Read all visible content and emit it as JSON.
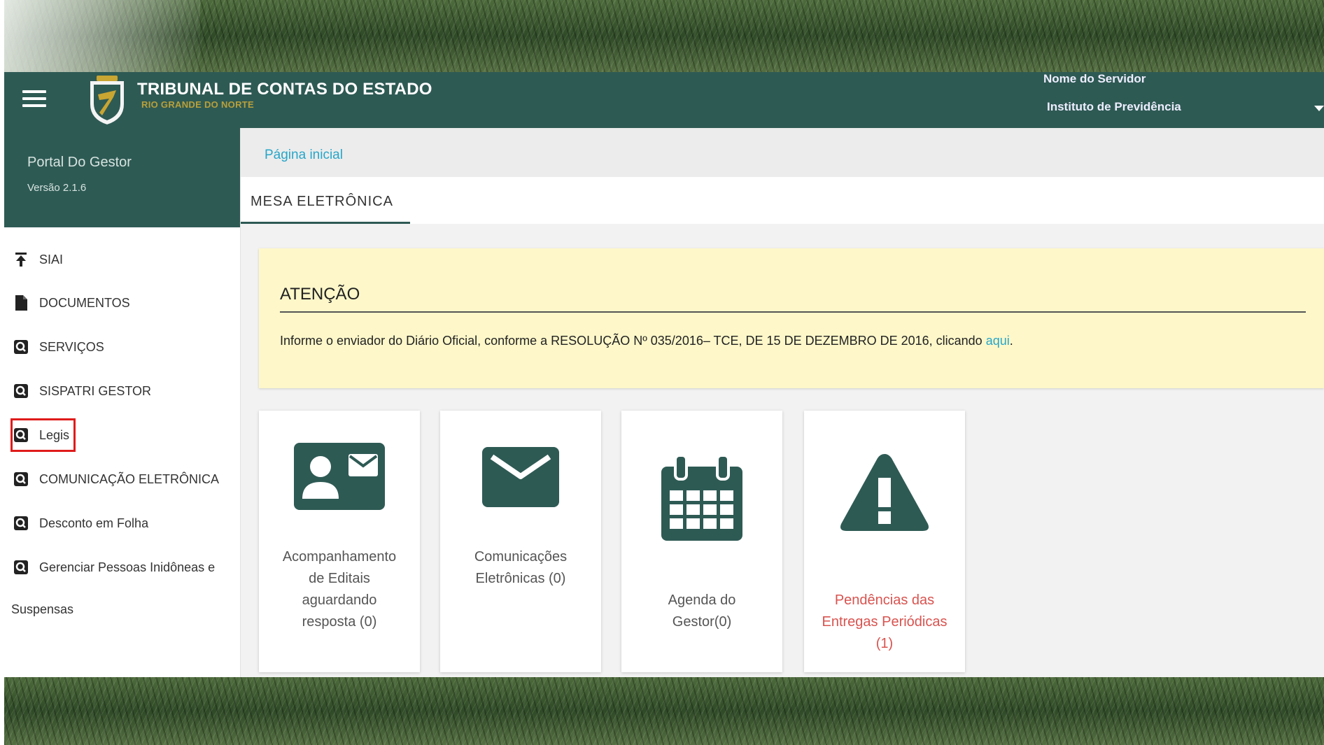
{
  "header": {
    "title": "TRIBUNAL DE CONTAS DO ESTADO",
    "subtitle": "RIO GRANDE DO NORTE",
    "user_name": "Nome do Servidor",
    "user_org": "Instituto de Previdência"
  },
  "sidebar": {
    "portal": "Portal Do Gestor",
    "version": "Versão 2.1.6",
    "items": [
      {
        "label": "SIAI",
        "icon": "upload-icon"
      },
      {
        "label": "DOCUMENTOS",
        "icon": "document-icon"
      },
      {
        "label": "SERVIÇOS",
        "icon": "search-doc-icon"
      },
      {
        "label": "SISPATRI GESTOR",
        "icon": "search-doc-icon"
      },
      {
        "label": "Legis",
        "icon": "search-doc-icon",
        "highlighted": true
      },
      {
        "label": "COMUNICAÇÃO ELETRÔNICA",
        "icon": "search-doc-icon"
      },
      {
        "label": "Desconto em Folha",
        "icon": "search-doc-icon"
      },
      {
        "label": "Gerenciar Pessoas Inidôneas e",
        "icon": "search-doc-icon"
      }
    ],
    "wrap_text": "Suspensas"
  },
  "breadcrumb": "Página inicial",
  "tabs": [
    {
      "label": "MESA ELETRÔNICA",
      "active": true
    }
  ],
  "alert": {
    "title": "ATENÇÃO",
    "text": "Informe o enviador do Diário Oficial, conforme a RESOLUÇÃO Nº 035/2016– TCE, DE 15 DE DEZEMBRO DE 2016, clicando ",
    "link": "aqui",
    "text_end": "."
  },
  "cards": [
    {
      "lines": [
        "Acompanhamento",
        "de Editais",
        "aguardando",
        "resposta (0)"
      ],
      "icon": "contact-mail-icon"
    },
    {
      "lines": [
        "Comunicações",
        "Eletrônicas (0)"
      ],
      "icon": "mail-icon"
    },
    {
      "lines": [
        "Agenda do",
        "Gestor(0)"
      ],
      "icon": "calendar-icon"
    },
    {
      "lines": [
        "Pendências das",
        "Entregas Periódicas",
        "(1)"
      ],
      "icon": "warning-icon"
    }
  ],
  "colors": {
    "primary": "#2e5a54",
    "link": "#27a6c9",
    "alert_bg": "#fdf7c9",
    "highlight": "#e01b1b",
    "warning_text": "#d9534f"
  }
}
